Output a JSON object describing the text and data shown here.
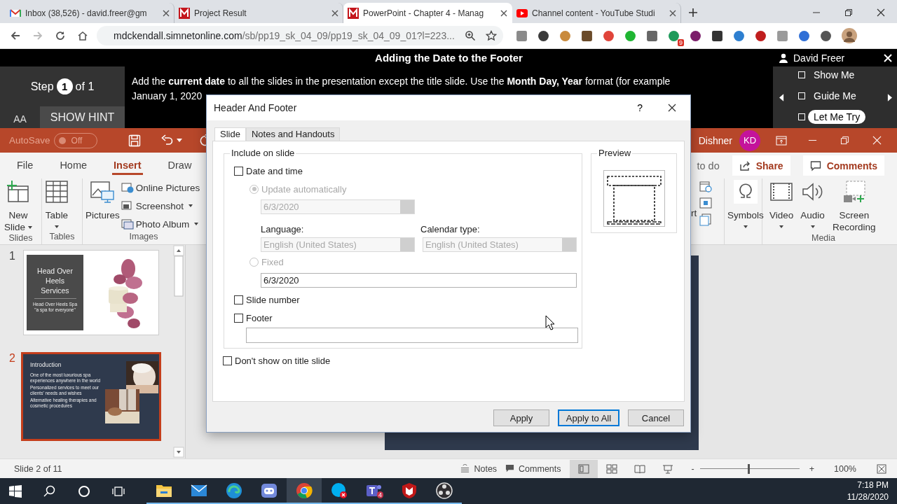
{
  "browser": {
    "tabs": [
      {
        "kind": "gmail",
        "title": "Inbox (38,526) - david.freer@gm",
        "selected": false
      },
      {
        "kind": "mcgraw",
        "title": "Project Result",
        "selected": false
      },
      {
        "kind": "mcgraw",
        "title": "PowerPoint - Chapter 4 - Manag",
        "selected": true
      },
      {
        "kind": "youtube",
        "title": "Channel content - YouTube Studi",
        "selected": false
      }
    ],
    "url_host": "mdckendall.simnetonline.com",
    "url_path": "/sb/pp19_sk_04_09/pp19_sk_04_09_01?l=223...",
    "extension_badge": "9"
  },
  "task_banner": {
    "title": "Adding the Date to the Footer",
    "user": "David Freer",
    "step_before": "Step",
    "step_number": "1",
    "step_after": "of 1",
    "font_button": "AA",
    "hint_button": "SHOW HINT",
    "instruction": "Add the **current date** to all the slides in the presentation except the title slide. Use the **Month Day, Year** format (for example",
    "instruction_line_2": "January 1, 2020",
    "modes": [
      {
        "label": "Show Me",
        "checked": false,
        "selected": false
      },
      {
        "label": "Guide Me",
        "checked": false,
        "selected": false
      },
      {
        "label": "Let Me Try",
        "checked": false,
        "selected": true
      }
    ]
  },
  "powerpoint": {
    "title_bar": {
      "autosave_label": "AutoSave",
      "autosave_toggle": {
        "label": "Off",
        "on": false
      },
      "user_name": "Dishner",
      "user_initials": "KD"
    },
    "ribbon_tabs": [
      {
        "label": "File",
        "selected": false
      },
      {
        "label": "Home",
        "selected": false
      },
      {
        "label": "Insert",
        "selected": true
      },
      {
        "label": "Draw",
        "selected": false
      }
    ],
    "search_text": "to do",
    "share_button": "Share",
    "comments_button": "Comments",
    "ribbon_groups": [
      {
        "label": "Slides",
        "items": [
          {
            "label": "New Slide",
            "dropdown": true
          }
        ]
      },
      {
        "label": "Tables",
        "items": [
          {
            "label": "Table",
            "dropdown": true
          }
        ]
      },
      {
        "label": "Images",
        "items": [
          {
            "label": "Pictures",
            "dropdown": false
          },
          {
            "label": "Online Pictures",
            "dropdown": false
          },
          {
            "label": "Screenshot",
            "dropdown": true
          },
          {
            "label": "Photo Album",
            "dropdown": true
          }
        ]
      }
    ],
    "ribbon_right": {
      "partial_label": "rt",
      "symbols": {
        "label": "Symbols",
        "dropdown": true
      },
      "media_group": {
        "label": "Media",
        "items": [
          {
            "label": "Video",
            "dropdown": true
          },
          {
            "label": "Audio",
            "dropdown": true
          },
          {
            "label": "Screen Recording",
            "dropdown": false
          }
        ]
      }
    },
    "slides": [
      {
        "number": "1",
        "selected": false,
        "title": "Head Over Heels Services",
        "subtitle_lines": [
          "Head Over Heels Spa",
          "\"a spa for everyone\""
        ]
      },
      {
        "number": "2",
        "selected": true,
        "title": "Introduction",
        "bullets": [
          "One of the most luxurious spa experiences anywhere in the world",
          "Personalized services to meet our clients' needs and wishes",
          "Alternative healing therapies and cosmetic procedures"
        ]
      }
    ],
    "status_bar": {
      "slide_position": "Slide 2 of 11",
      "notes": "Notes",
      "comments": "Comments",
      "zoom_minus": "-",
      "zoom_plus": "+",
      "zoom": {
        "level": 0.49
      },
      "zoom_percent": "100%"
    }
  },
  "dialog": {
    "title": "Header And Footer",
    "help": "?",
    "tabs": [
      {
        "label": "Slide",
        "selected": true
      },
      {
        "label": "Notes and Handouts",
        "selected": false
      }
    ],
    "include_group": {
      "legend": "Include on slide",
      "date_and_time": {
        "label": "Date and time",
        "checked": false
      },
      "update_automatically": {
        "label": "Update automatically",
        "selected": true,
        "disabled": true
      },
      "auto_date": {
        "value": "6/3/2020",
        "disabled": true
      },
      "language": {
        "label": "Language:",
        "value": "English (United States)",
        "disabled": true
      },
      "calendar_type": {
        "label": "Calendar type:",
        "value": "English (United States)",
        "disabled": true
      },
      "fixed": {
        "label": "Fixed",
        "selected": false,
        "disabled": true
      },
      "fixed_date": {
        "value": "6/3/2020"
      },
      "slide_number": {
        "label": "Slide number",
        "checked": false
      },
      "footer": {
        "label": "Footer",
        "checked": false
      }
    },
    "preview_label": "Preview",
    "dont_show_on_title": {
      "label": "Don't show on title slide",
      "checked": false
    },
    "buttons": [
      {
        "label": "Apply",
        "default": false
      },
      {
        "label": "Apply to All",
        "default": true
      },
      {
        "label": "Cancel",
        "default": false
      }
    ]
  },
  "taskbar": {
    "apps": [
      {
        "selected": false
      },
      {
        "selected": false
      },
      {
        "selected": false
      },
      {
        "selected": false
      },
      {
        "selected": true
      },
      {
        "selected": false
      },
      {
        "selected": false,
        "badge": "4"
      },
      {
        "selected": false
      },
      {
        "selected": false
      }
    ],
    "time": "7:18 PM",
    "date": "11/28/2020"
  }
}
